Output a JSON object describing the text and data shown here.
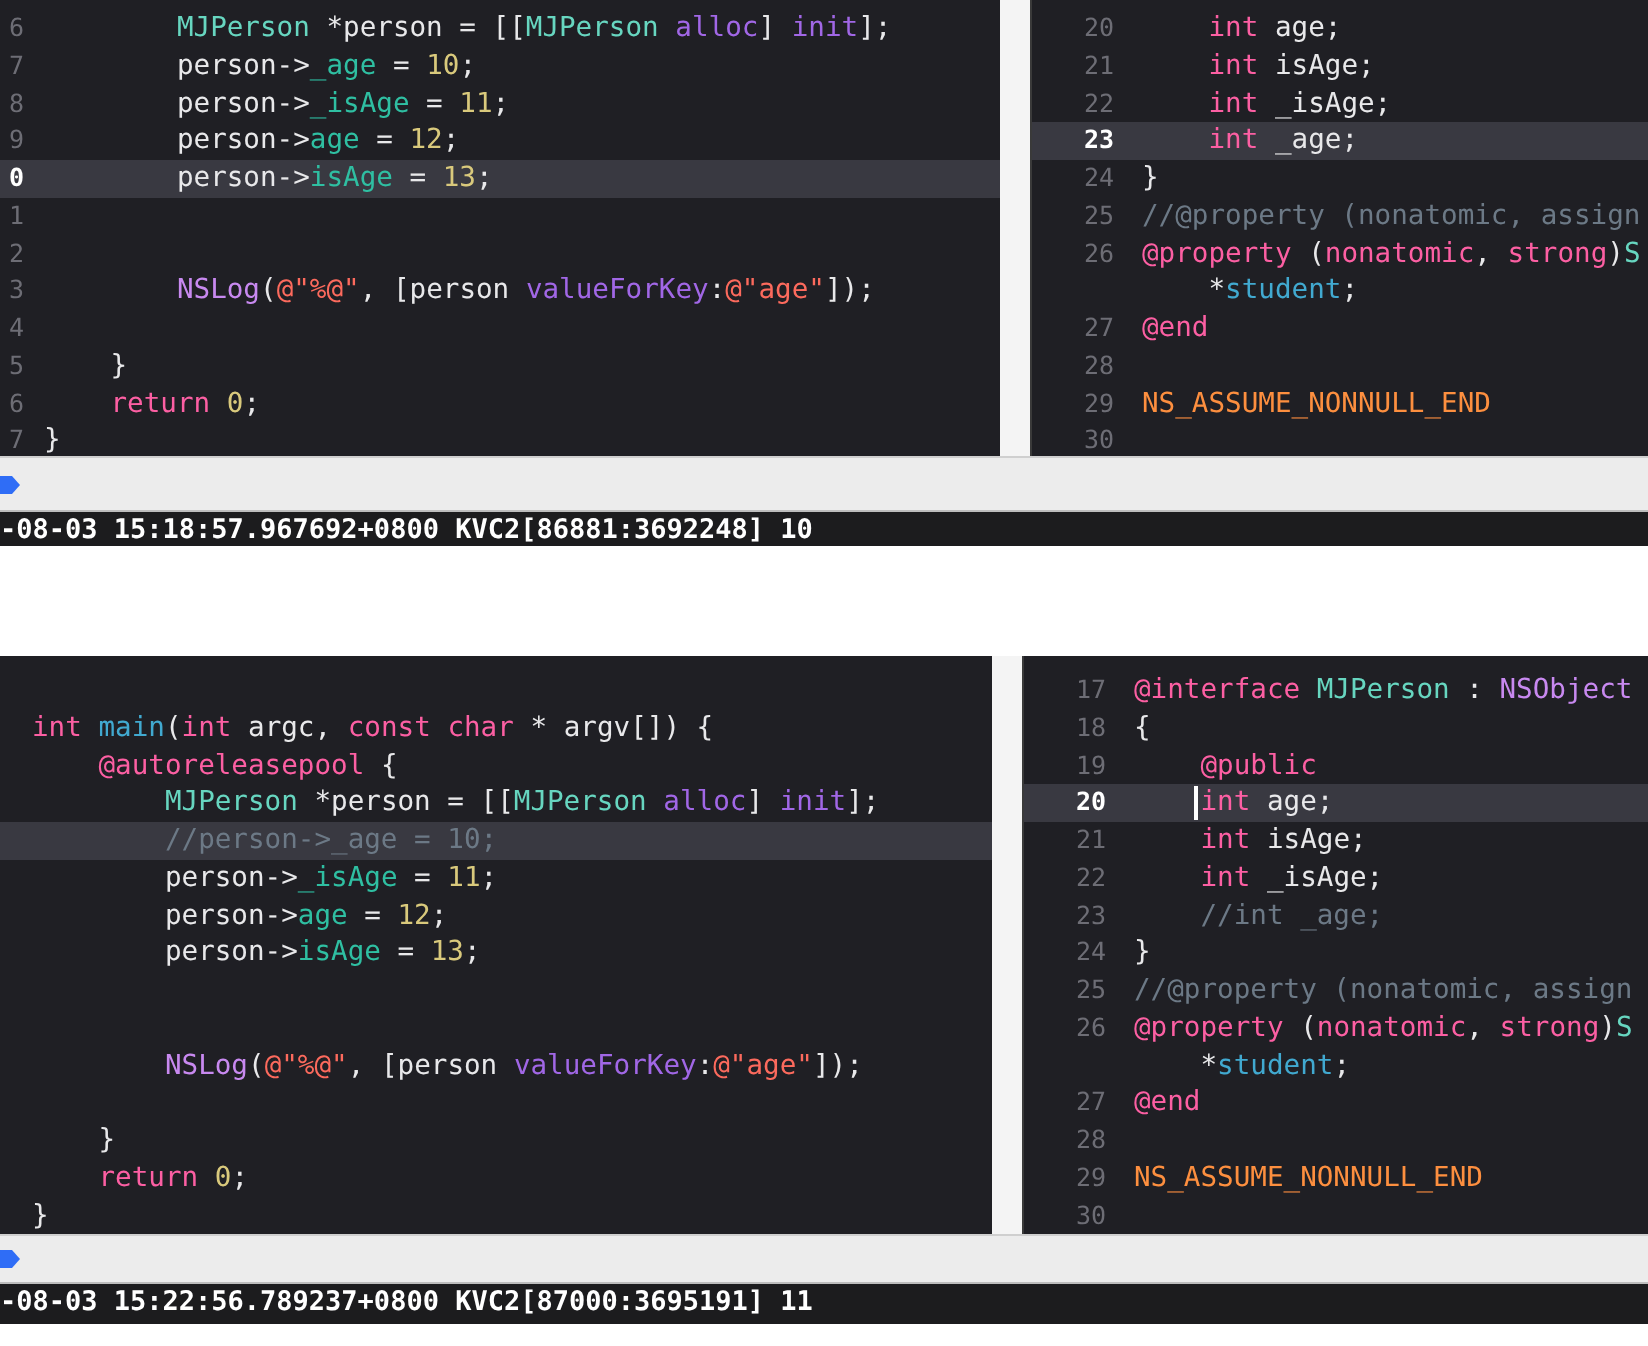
{
  "panels": [
    {
      "editors": [
        {
          "lines": [
            {
              "number": "6",
              "current": false,
              "tokens": [
                {
                  "kind": "type",
                  "text": "        MJPerson"
                },
                {
                  "kind": "plain",
                  "text": " *person = [["
                },
                {
                  "kind": "type",
                  "text": "MJPerson "
                },
                {
                  "kind": "method",
                  "text": "alloc"
                },
                {
                  "kind": "plain",
                  "text": "] "
                },
                {
                  "kind": "method",
                  "text": "init"
                },
                {
                  "kind": "plain",
                  "text": "];"
                }
              ]
            },
            {
              "number": "7",
              "current": false,
              "tokens": [
                {
                  "kind": "plain",
                  "text": "        person->"
                },
                {
                  "kind": "ivar",
                  "text": "_age"
                },
                {
                  "kind": "plain",
                  "text": " = "
                },
                {
                  "kind": "number",
                  "text": "10"
                },
                {
                  "kind": "plain",
                  "text": ";"
                }
              ]
            },
            {
              "number": "8",
              "current": false,
              "tokens": [
                {
                  "kind": "plain",
                  "text": "        person->"
                },
                {
                  "kind": "ivar",
                  "text": "_isAge"
                },
                {
                  "kind": "plain",
                  "text": " = "
                },
                {
                  "kind": "number",
                  "text": "11"
                },
                {
                  "kind": "plain",
                  "text": ";"
                }
              ]
            },
            {
              "number": "9",
              "current": false,
              "tokens": [
                {
                  "kind": "plain",
                  "text": "        person->"
                },
                {
                  "kind": "ivar",
                  "text": "age"
                },
                {
                  "kind": "plain",
                  "text": " = "
                },
                {
                  "kind": "number",
                  "text": "12"
                },
                {
                  "kind": "plain",
                  "text": ";"
                }
              ]
            },
            {
              "number": "0",
              "current": true,
              "tokens": [
                {
                  "kind": "plain",
                  "text": "        person->"
                },
                {
                  "kind": "ivar",
                  "text": "isAge"
                },
                {
                  "kind": "plain",
                  "text": " = "
                },
                {
                  "kind": "number",
                  "text": "13"
                },
                {
                  "kind": "plain",
                  "text": ";"
                }
              ]
            },
            {
              "number": "1",
              "current": false
            },
            {
              "number": "2",
              "current": false
            },
            {
              "number": "3",
              "current": false,
              "tokens": [
                {
                  "kind": "system",
                  "text": "        NSLog"
                },
                {
                  "kind": "plain",
                  "text": "("
                },
                {
                  "kind": "string",
                  "text": "@\"%@\""
                },
                {
                  "kind": "plain",
                  "text": ", [person "
                },
                {
                  "kind": "method",
                  "text": "valueForKey"
                },
                {
                  "kind": "plain",
                  "text": ":"
                },
                {
                  "kind": "string",
                  "text": "@\"age\""
                },
                {
                  "kind": "plain",
                  "text": "]);"
                }
              ]
            },
            {
              "number": "4",
              "current": false
            },
            {
              "number": "5",
              "current": false,
              "tokens": [
                {
                  "kind": "plain",
                  "text": "    }"
                }
              ]
            },
            {
              "number": "6",
              "current": false,
              "tokens": [
                {
                  "kind": "keyword",
                  "text": "    return "
                },
                {
                  "kind": "number",
                  "text": "0"
                },
                {
                  "kind": "plain",
                  "text": ";"
                }
              ]
            },
            {
              "number": "7",
              "current": false,
              "tokens": [
                {
                  "kind": "plain",
                  "text": "}"
                }
              ]
            }
          ]
        },
        {
          "lines": [
            {
              "number": "20",
              "current": false,
              "tokens": [
                {
                  "kind": "keyword",
                  "text": "    int"
                },
                {
                  "kind": "plain",
                  "text": " age;"
                }
              ]
            },
            {
              "number": "21",
              "current": false,
              "tokens": [
                {
                  "kind": "keyword",
                  "text": "    int"
                },
                {
                  "kind": "plain",
                  "text": " isAge;"
                }
              ]
            },
            {
              "number": "22",
              "current": false,
              "tokens": [
                {
                  "kind": "keyword",
                  "text": "    int"
                },
                {
                  "kind": "plain",
                  "text": " _isAge;"
                }
              ]
            },
            {
              "number": "23",
              "current": true,
              "tokens": [
                {
                  "kind": "keyword",
                  "text": "    int"
                },
                {
                  "kind": "plain",
                  "text": " _age;"
                }
              ]
            },
            {
              "number": "24",
              "current": false,
              "tokens": [
                {
                  "kind": "plain",
                  "text": "}"
                }
              ]
            },
            {
              "number": "25",
              "current": false,
              "tokens": [
                {
                  "kind": "comment",
                  "text": "//@property (nonatomic, assign"
                }
              ]
            },
            {
              "number": "26",
              "current": false,
              "tokens": [
                {
                  "kind": "keyword",
                  "text": "@property"
                },
                {
                  "kind": "plain",
                  "text": " ("
                },
                {
                  "kind": "keyword",
                  "text": "nonatomic"
                },
                {
                  "kind": "plain",
                  "text": ", "
                },
                {
                  "kind": "keyword",
                  "text": "strong"
                },
                {
                  "kind": "plain",
                  "text": ")"
                },
                {
                  "kind": "type",
                  "text": "S"
                }
              ]
            },
            {
              "current": false,
              "tokens": [
                {
                  "kind": "plain",
                  "text": "    *"
                },
                {
                  "kind": "decl",
                  "text": "student"
                },
                {
                  "kind": "plain",
                  "text": ";"
                }
              ]
            },
            {
              "number": "27",
              "current": false,
              "tokens": [
                {
                  "kind": "keyword",
                  "text": "@end"
                }
              ]
            },
            {
              "number": "28",
              "current": false
            },
            {
              "number": "29",
              "current": false,
              "tokens": [
                {
                  "kind": "macro",
                  "text": "NS_ASSUME_NONNULL_END"
                }
              ]
            },
            {
              "number": "30",
              "current": false
            }
          ]
        }
      ],
      "console": {
        "output": "-08-03 15:18:57.967692+0800 KVC2[86881:3692248] 10"
      }
    },
    {
      "editors": [
        {
          "lines": [
            {
              "current": false
            },
            {
              "current": false,
              "tokens": [
                {
                  "kind": "keyword",
                  "text": "int "
                },
                {
                  "kind": "decl",
                  "text": "main"
                },
                {
                  "kind": "plain",
                  "text": "("
                },
                {
                  "kind": "keyword",
                  "text": "int"
                },
                {
                  "kind": "plain",
                  "text": " argc, "
                },
                {
                  "kind": "keyword",
                  "text": "const char"
                },
                {
                  "kind": "plain",
                  "text": " * argv[]) {"
                }
              ]
            },
            {
              "current": false,
              "tokens": [
                {
                  "kind": "keyword",
                  "text": "    @autoreleasepool"
                },
                {
                  "kind": "plain",
                  "text": " {"
                }
              ]
            },
            {
              "current": false,
              "tokens": [
                {
                  "kind": "type",
                  "text": "        MJPerson"
                },
                {
                  "kind": "plain",
                  "text": " *person = [["
                },
                {
                  "kind": "type",
                  "text": "MJPerson "
                },
                {
                  "kind": "method",
                  "text": "alloc"
                },
                {
                  "kind": "plain",
                  "text": "] "
                },
                {
                  "kind": "method",
                  "text": "init"
                },
                {
                  "kind": "plain",
                  "text": "];"
                }
              ]
            },
            {
              "current": true,
              "tokens": [
                {
                  "kind": "comment",
                  "text": "        //person->_age = 10;"
                }
              ]
            },
            {
              "current": false,
              "tokens": [
                {
                  "kind": "plain",
                  "text": "        person->"
                },
                {
                  "kind": "ivar",
                  "text": "_isAge"
                },
                {
                  "kind": "plain",
                  "text": " = "
                },
                {
                  "kind": "number",
                  "text": "11"
                },
                {
                  "kind": "plain",
                  "text": ";"
                }
              ]
            },
            {
              "current": false,
              "tokens": [
                {
                  "kind": "plain",
                  "text": "        person->"
                },
                {
                  "kind": "ivar",
                  "text": "age"
                },
                {
                  "kind": "plain",
                  "text": " = "
                },
                {
                  "kind": "number",
                  "text": "12"
                },
                {
                  "kind": "plain",
                  "text": ";"
                }
              ]
            },
            {
              "current": false,
              "tokens": [
                {
                  "kind": "plain",
                  "text": "        person->"
                },
                {
                  "kind": "ivar",
                  "text": "isAge"
                },
                {
                  "kind": "plain",
                  "text": " = "
                },
                {
                  "kind": "number",
                  "text": "13"
                },
                {
                  "kind": "plain",
                  "text": ";"
                }
              ]
            },
            {
              "current": false
            },
            {
              "current": false
            },
            {
              "current": false,
              "tokens": [
                {
                  "kind": "system",
                  "text": "        NSLog"
                },
                {
                  "kind": "plain",
                  "text": "("
                },
                {
                  "kind": "string",
                  "text": "@\"%@\""
                },
                {
                  "kind": "plain",
                  "text": ", [person "
                },
                {
                  "kind": "method",
                  "text": "valueForKey"
                },
                {
                  "kind": "plain",
                  "text": ":"
                },
                {
                  "kind": "string",
                  "text": "@\"age\""
                },
                {
                  "kind": "plain",
                  "text": "]);"
                }
              ]
            },
            {
              "current": false
            },
            {
              "current": false,
              "tokens": [
                {
                  "kind": "plain",
                  "text": "    }"
                }
              ]
            },
            {
              "current": false,
              "tokens": [
                {
                  "kind": "keyword",
                  "text": "    return "
                },
                {
                  "kind": "number",
                  "text": "0"
                },
                {
                  "kind": "plain",
                  "text": ";"
                }
              ]
            },
            {
              "current": false,
              "tokens": [
                {
                  "kind": "plain",
                  "text": "}"
                }
              ]
            }
          ]
        },
        {
          "lines": [
            {
              "number": "17",
              "current": false,
              "tokens": [
                {
                  "kind": "keyword",
                  "text": "@interface "
                },
                {
                  "kind": "type",
                  "text": "MJPerson"
                },
                {
                  "kind": "plain",
                  "text": " : "
                },
                {
                  "kind": "system",
                  "text": "NSObject"
                }
              ]
            },
            {
              "number": "18",
              "current": false,
              "tokens": [
                {
                  "kind": "plain",
                  "text": "{"
                }
              ]
            },
            {
              "number": "19",
              "current": false,
              "tokens": [
                {
                  "kind": "keyword",
                  "text": "    @public"
                }
              ]
            },
            {
              "number": "20",
              "current": true,
              "tokens": [
                {
                  "kind": "caret"
                },
                {
                  "kind": "keyword",
                  "text": "    int"
                },
                {
                  "kind": "plain",
                  "text": " age;"
                }
              ]
            },
            {
              "number": "21",
              "current": false,
              "tokens": [
                {
                  "kind": "keyword",
                  "text": "    int"
                },
                {
                  "kind": "plain",
                  "text": " isAge;"
                }
              ]
            },
            {
              "number": "22",
              "current": false,
              "tokens": [
                {
                  "kind": "keyword",
                  "text": "    int"
                },
                {
                  "kind": "plain",
                  "text": " _isAge;"
                }
              ]
            },
            {
              "number": "23",
              "current": false,
              "tokens": [
                {
                  "kind": "comment",
                  "text": "    //int _age;"
                }
              ]
            },
            {
              "number": "24",
              "current": false,
              "tokens": [
                {
                  "kind": "plain",
                  "text": "}"
                }
              ]
            },
            {
              "number": "25",
              "current": false,
              "tokens": [
                {
                  "kind": "comment",
                  "text": "//@property (nonatomic, assign"
                }
              ]
            },
            {
              "number": "26",
              "current": false,
              "tokens": [
                {
                  "kind": "keyword",
                  "text": "@property"
                },
                {
                  "kind": "plain",
                  "text": " ("
                },
                {
                  "kind": "keyword",
                  "text": "nonatomic"
                },
                {
                  "kind": "plain",
                  "text": ", "
                },
                {
                  "kind": "keyword",
                  "text": "strong"
                },
                {
                  "kind": "plain",
                  "text": ")"
                },
                {
                  "kind": "type",
                  "text": "S"
                }
              ]
            },
            {
              "current": false,
              "tokens": [
                {
                  "kind": "plain",
                  "text": "    *"
                },
                {
                  "kind": "decl",
                  "text": "student"
                },
                {
                  "kind": "plain",
                  "text": ";"
                }
              ]
            },
            {
              "number": "27",
              "current": false,
              "tokens": [
                {
                  "kind": "keyword",
                  "text": "@end"
                }
              ]
            },
            {
              "number": "28",
              "current": false
            },
            {
              "number": "29",
              "current": false,
              "tokens": [
                {
                  "kind": "macro",
                  "text": "NS_ASSUME_NONNULL_END"
                }
              ]
            },
            {
              "number": "30",
              "current": false
            }
          ]
        }
      ],
      "console": {
        "output": "-08-03 15:22:56.789237+0800 KVC2[87000:3695191] 11"
      }
    }
  ]
}
